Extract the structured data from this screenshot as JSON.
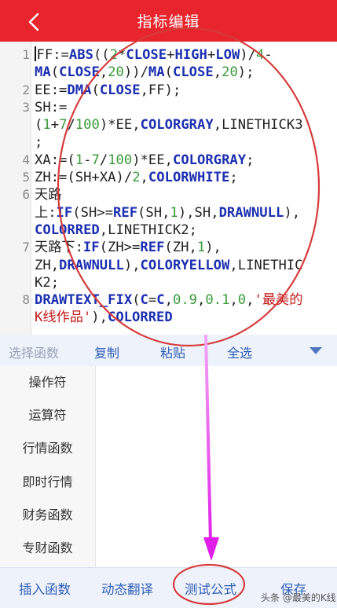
{
  "header": {
    "title": "指标编辑",
    "back_icon": "chevron-left-icon",
    "bg_color": "#e8252c"
  },
  "editor": {
    "line_numbers": [
      "1",
      "2",
      "3",
      "4",
      "5",
      "6",
      "7",
      "8"
    ],
    "lines": [
      "FF:=ABS((2*CLOSE+HIGH+LOW)/4-MA(CLOSE,20))/MA(CLOSE,20);",
      "EE:=DMA(CLOSE,FF);",
      "SH:=(1+7/100)*EE,COLORGRAY,LINETHICK3;",
      "XA:=(1-7/100)*EE,COLORGRAY;",
      "ZH:=(SH+XA)/2,COLORWHITE;",
      "天路上:IF(SH>=REF(SH,1),SH,DRAWNULL),COLORRED,LINETHICK2;",
      "天路下:IF(ZH>=REF(ZH,1),ZH,DRAWNULL),COLORYELLOW,LINETHICK2;",
      "DRAWTEXT_FIX(C=C,0.9,0.1,0,'最美的K线作品'),COLORRED"
    ]
  },
  "toolbar": {
    "select_function": "选择函数",
    "copy": "复制",
    "paste": "粘贴",
    "select_all": "全选",
    "expand_icon": "triangle-down-icon"
  },
  "categories": [
    "操作符",
    "运算符",
    "行情函数",
    "即时行情",
    "财务函数",
    "专财函数"
  ],
  "bottom_bar": {
    "insert_function": "插入函数",
    "dynamic_translate": "动态翻译",
    "test_formula": "测试公式",
    "save": "保存"
  },
  "watermark": "头条 @最美的K线",
  "colors": {
    "accent": "#2f5fb8",
    "keyword": "#1c2fb0",
    "number": "#3b9a3b",
    "annotation_circle": "#d63b3b",
    "annotation_arrow": "#e030e8"
  }
}
